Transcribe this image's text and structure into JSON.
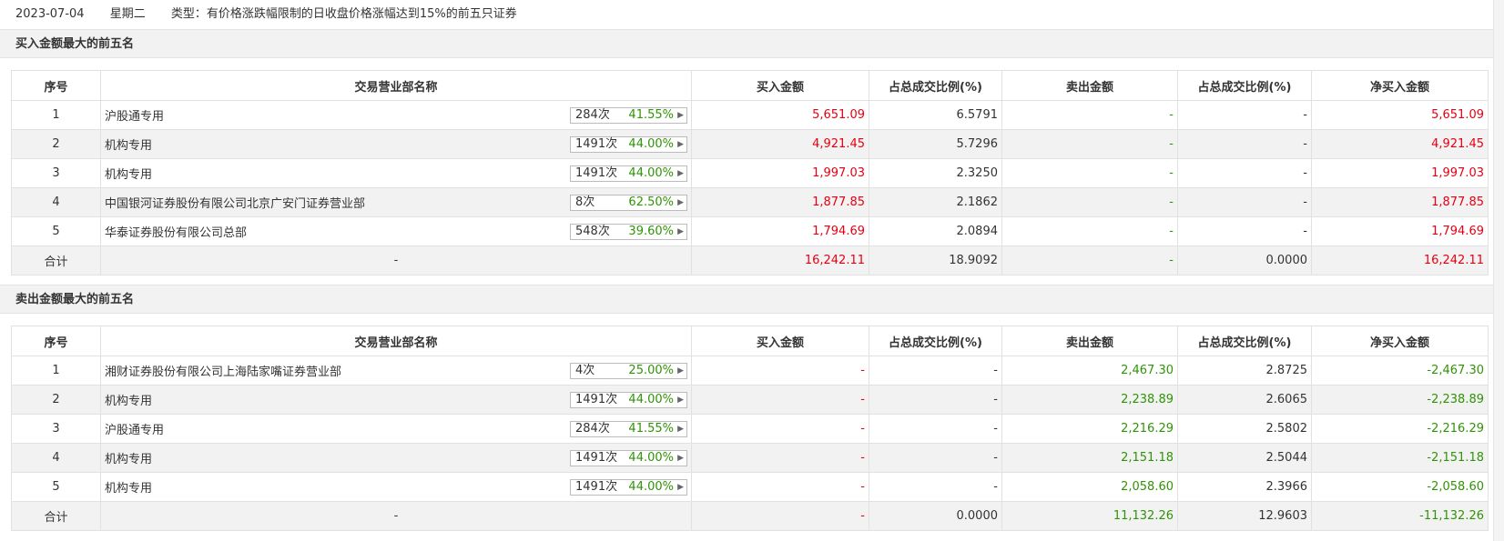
{
  "header": {
    "date": "2023-07-04",
    "weekday": "星期二",
    "type_label": "类型：有价格涨跌幅限制的日收盘价格涨幅达到15%的前五只证券"
  },
  "buy_section": {
    "title": "买入金额最大的前五名",
    "columns": [
      "序号",
      "交易营业部名称",
      "买入金额",
      "占总成交比例(%)",
      "卖出金额",
      "占总成交比例(%)",
      "净买入金额"
    ],
    "rows": [
      {
        "idx": "1",
        "name": "沪股通专用",
        "count": "284次",
        "rate": "41.55%",
        "buy": "5,651.09",
        "buy_pct": "6.5791",
        "sell": "-",
        "sell_pct": "-",
        "net": "5,651.09"
      },
      {
        "idx": "2",
        "name": "机构专用",
        "count": "1491次",
        "rate": "44.00%",
        "buy": "4,921.45",
        "buy_pct": "5.7296",
        "sell": "-",
        "sell_pct": "-",
        "net": "4,921.45"
      },
      {
        "idx": "3",
        "name": "机构专用",
        "count": "1491次",
        "rate": "44.00%",
        "buy": "1,997.03",
        "buy_pct": "2.3250",
        "sell": "-",
        "sell_pct": "-",
        "net": "1,997.03"
      },
      {
        "idx": "4",
        "name": "中国银河证券股份有限公司北京广安门证券营业部",
        "count": "8次",
        "rate": "62.50%",
        "buy": "1,877.85",
        "buy_pct": "2.1862",
        "sell": "-",
        "sell_pct": "-",
        "net": "1,877.85"
      },
      {
        "idx": "5",
        "name": "华泰证券股份有限公司总部",
        "count": "548次",
        "rate": "39.60%",
        "buy": "1,794.69",
        "buy_pct": "2.0894",
        "sell": "-",
        "sell_pct": "-",
        "net": "1,794.69"
      }
    ],
    "total": {
      "label": "合计",
      "name": "-",
      "buy": "16,242.11",
      "buy_pct": "18.9092",
      "sell": "-",
      "sell_pct": "0.0000",
      "net": "16,242.11"
    }
  },
  "sell_section": {
    "title": "卖出金额最大的前五名",
    "columns": [
      "序号",
      "交易营业部名称",
      "买入金额",
      "占总成交比例(%)",
      "卖出金额",
      "占总成交比例(%)",
      "净买入金额"
    ],
    "rows": [
      {
        "idx": "1",
        "name": "湘财证券股份有限公司上海陆家嘴证券营业部",
        "count": "4次",
        "rate": "25.00%",
        "buy": "-",
        "buy_pct": "-",
        "sell": "2,467.30",
        "sell_pct": "2.8725",
        "net": "-2,467.30"
      },
      {
        "idx": "2",
        "name": "机构专用",
        "count": "1491次",
        "rate": "44.00%",
        "buy": "-",
        "buy_pct": "-",
        "sell": "2,238.89",
        "sell_pct": "2.6065",
        "net": "-2,238.89"
      },
      {
        "idx": "3",
        "name": "沪股通专用",
        "count": "284次",
        "rate": "41.55%",
        "buy": "-",
        "buy_pct": "-",
        "sell": "2,216.29",
        "sell_pct": "2.5802",
        "net": "-2,216.29"
      },
      {
        "idx": "4",
        "name": "机构专用",
        "count": "1491次",
        "rate": "44.00%",
        "buy": "-",
        "buy_pct": "-",
        "sell": "2,151.18",
        "sell_pct": "2.5044",
        "net": "-2,151.18"
      },
      {
        "idx": "5",
        "name": "机构专用",
        "count": "1491次",
        "rate": "44.00%",
        "buy": "-",
        "buy_pct": "-",
        "sell": "2,058.60",
        "sell_pct": "2.3966",
        "net": "-2,058.60"
      }
    ],
    "total": {
      "label": "合计",
      "name": "-",
      "buy": "-",
      "buy_pct": "0.0000",
      "sell": "11,132.26",
      "sell_pct": "12.9603",
      "net": "-11,132.26"
    }
  },
  "icons": {
    "badge_arrow": "caret-right-icon"
  },
  "colors": {
    "up": "#e60012",
    "down": "#2f9405",
    "stripe": "#f2f2f2",
    "border": "#e1e1e1"
  }
}
